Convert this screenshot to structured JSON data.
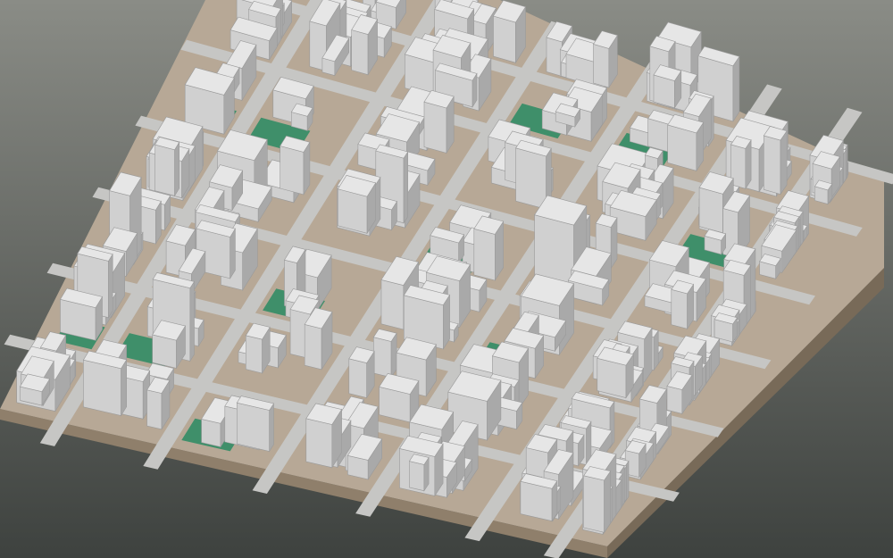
{
  "colors": {
    "background_top": "#8a8c86",
    "background_bottom": "#3e423f",
    "ground": "#b7a896",
    "base_side_front": "#8f7f6b",
    "base_side_right": "#786a58",
    "street": "#c6c6c4",
    "park": "#3f8f6a",
    "building_top": "#e6e6e6",
    "building_left": "#d0d0d0",
    "building_right": "#a9a9a9",
    "building_edge": "#9a9a9a"
  },
  "scene": {
    "view": "isometric-3d-city-model",
    "icons": [
      "city-block-model"
    ]
  }
}
